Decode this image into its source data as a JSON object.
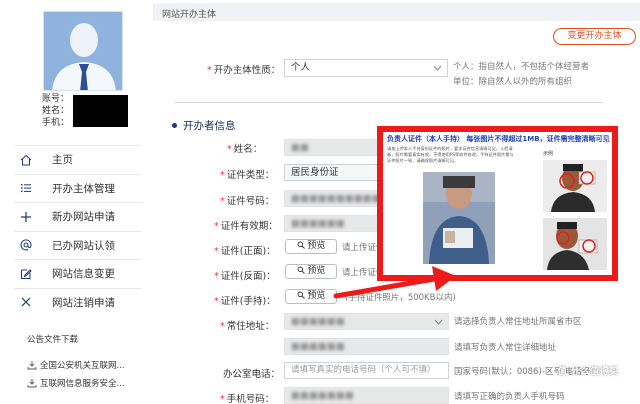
{
  "sidebar": {
    "user_info": {
      "account_label": "账号：",
      "name_label": "姓名：",
      "phone_label": "手机："
    },
    "menu": [
      {
        "label": "主页",
        "icon": "home-icon"
      },
      {
        "label": "开办主体管理",
        "icon": "list-icon"
      },
      {
        "label": "新办网站申请",
        "icon": "plus-icon"
      },
      {
        "label": "已办网站认领",
        "icon": "at-icon"
      },
      {
        "label": "网站信息变更",
        "icon": "edit-icon"
      },
      {
        "label": "网站注销申请",
        "icon": "close-icon"
      }
    ],
    "notice_title": "公告文件下载",
    "notices": [
      "全国公安机关互联网...",
      "互联网信息服务安全..."
    ]
  },
  "main": {
    "topbar_title": "网站开办主体",
    "change_button": "变更开办主体",
    "subject_type": {
      "label": "开办主体性质：",
      "value": "个人",
      "hint_line1": "个人：指自然人，不包括个体经营者",
      "hint_line2": "单位：除自然人以外的所有组织"
    },
    "section_title": "开办者信息",
    "fields": {
      "name": {
        "label": "姓名：",
        "value": "■■"
      },
      "id_type": {
        "label": "证件类型：",
        "value": "居民身份证"
      },
      "id_number": {
        "label": "证件号码：",
        "value": "■■■■■■■■■■"
      },
      "id_validity": {
        "label": "证件有效期：",
        "value": "■■■■■■"
      },
      "id_front": {
        "label": "证件(正面)：",
        "button": "预览",
        "hint": "请上传证件"
      },
      "id_back": {
        "label": "证件(反面)：",
        "button": "预览",
        "hint": "请上传证件"
      },
      "id_handheld": {
        "label": "证件(手持)：",
        "button": "预览",
        "hint": "(手持证件照片，500KB以内)"
      },
      "residence": {
        "label": "常住地址：",
        "value": "■■■■■■",
        "hint": "请选择负责人常住地址所属省市区"
      },
      "residence_detail": {
        "value": "■■■■■■",
        "hint": "请填写负责人常住详细地址"
      },
      "office_phone": {
        "label": "办公室电话：",
        "placeholder": "请填写真实的电话号码（个人可不填）",
        "hint": "国家号码(默认：0086)-区号-电话号码"
      },
      "mobile": {
        "label": "手机号码：",
        "value": "■■■■■■■",
        "hint": "请填写正确的负责人手机号码"
      }
    }
  },
  "overlay": {
    "title": "负责人证件（本人手持） 每张图片不得超过1MB，证件需完整清晰可见",
    "text": "请按上传本人手持身份证件的照片，要求证件信息清晰可见，人脸清晰，照片需要真实有效，不得使用PS等软件修改，手持证件照片需与证件照片一致，请确保照片清晰可见。",
    "sample_label": "示例"
  },
  "watermark": "值 什么值得买",
  "colors": {
    "accent": "#1d3a7a",
    "warning": "#e0501e",
    "highlight": "#ee1a1a"
  }
}
